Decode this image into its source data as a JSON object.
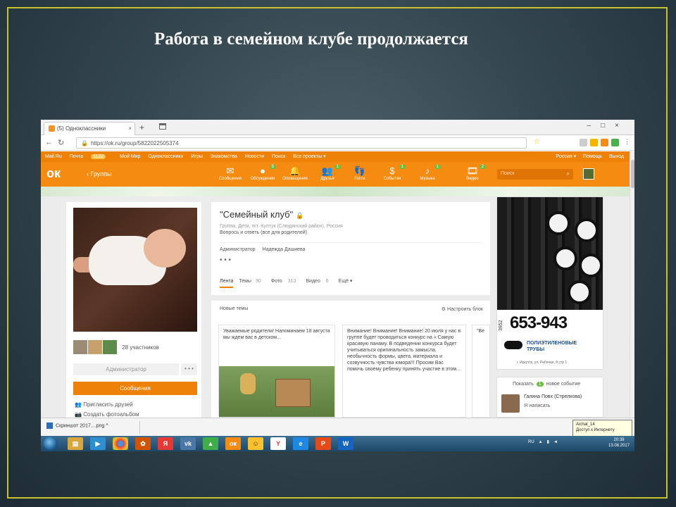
{
  "slide": {
    "title": "Работа в семейном клубе продолжается"
  },
  "browser": {
    "tab_title": "(5) Одноклассники",
    "url": "https://ok.ru/group/5822022505374",
    "tab_close": "×",
    "new_tab": "+",
    "window_controls": "–□×"
  },
  "ok_menu": {
    "items": [
      "Mail.Ru",
      "Почта",
      "Мой Мир",
      "Одноклассники",
      "Игры",
      "Знакомства",
      "Новости",
      "Поиск",
      "Все проекты ▾"
    ],
    "mail_badge": "1122",
    "right": [
      "Россия ▾",
      "Помощь",
      "Выход"
    ]
  },
  "ok_header": {
    "back_label": "Группы",
    "nav": [
      {
        "label": "Сообщения",
        "icon": "✉",
        "badge": ""
      },
      {
        "label": "Обсуждения",
        "icon": "●",
        "badge": "5"
      },
      {
        "label": "Оповещения",
        "icon": "🔔",
        "badge": ""
      },
      {
        "label": "Друзья",
        "icon": "👥",
        "badge": "1"
      },
      {
        "label": "Гости",
        "icon": "👣",
        "badge": ""
      },
      {
        "label": "События",
        "icon": "$",
        "badge": "1"
      },
      {
        "label": "Музыка",
        "icon": "♪",
        "badge": "1"
      },
      {
        "label": "Видео",
        "icon": "🎞",
        "badge": "2"
      }
    ],
    "search_placeholder": "Поиск"
  },
  "group": {
    "title": "\"Семейный клуб\"",
    "meta": "Группа, Дети, пгт. Култук (Слюдянский район), Россия",
    "subtitle": "Вопрось и ответь (все для родителей)",
    "admin_role": "Администратор",
    "admin_name": "Надежда Дашиева",
    "dots": "• • •",
    "tabs": [
      {
        "label": "Лента",
        "count": ""
      },
      {
        "label": "Темы",
        "count": "30"
      },
      {
        "label": "Фото",
        "count": "313"
      },
      {
        "label": "Видео",
        "count": "6"
      },
      {
        "label": "Ещё ▾",
        "count": ""
      }
    ]
  },
  "left": {
    "members": "28 участников",
    "admin_button": "Администратор",
    "more_button": "• • •",
    "messages_button": "Сообщения",
    "invite": "Пригласить друзей",
    "create_album": "Создать фотоальбом"
  },
  "topics": {
    "header": "Новые темы",
    "settings": "Настроить блок",
    "cards": [
      {
        "text": "Уважаемые родители! Напоминаем 18 августа мы ждем вас в детском..."
      },
      {
        "text": "Внимание! Внимание! Внимание! 20 июля у нас в группе будет проводиться конкурс на « Самую красивую панаму. В подведении конкурса будет учитываться оригинальность замысла, необычность формы, цвета, материала и созвучность чувства юмора!!! Просим Вас помочь своему ребенку принять участие в этом..."
      },
      {
        "text": "\"Ве"
      }
    ]
  },
  "ad": {
    "phone": "653-943",
    "code": "3952",
    "line1": "ПОЛИЭТИЛЕНОВЫЕ",
    "line2": "ТРУБЫ",
    "address": "г. Иркутск, ул. Рабочая, 8 стр 1"
  },
  "events": {
    "show": "Показать",
    "count": "1",
    "new_event": "новое событие",
    "person": "Галина Повх (Стрелкова)",
    "write": "написать"
  },
  "downloads": {
    "file": "Скриншот 2017....png",
    "arrow": "^"
  },
  "tooltip": {
    "line1": "Aichat_14",
    "line2": "Доступ к Интернету"
  },
  "taskbar": {
    "lang": "RU",
    "time": "20:39",
    "date": "13.08.2017"
  },
  "colors": {
    "ok_orange": "#ee8208",
    "accent_green": "#69bd3f",
    "frame": "#c9c230"
  }
}
